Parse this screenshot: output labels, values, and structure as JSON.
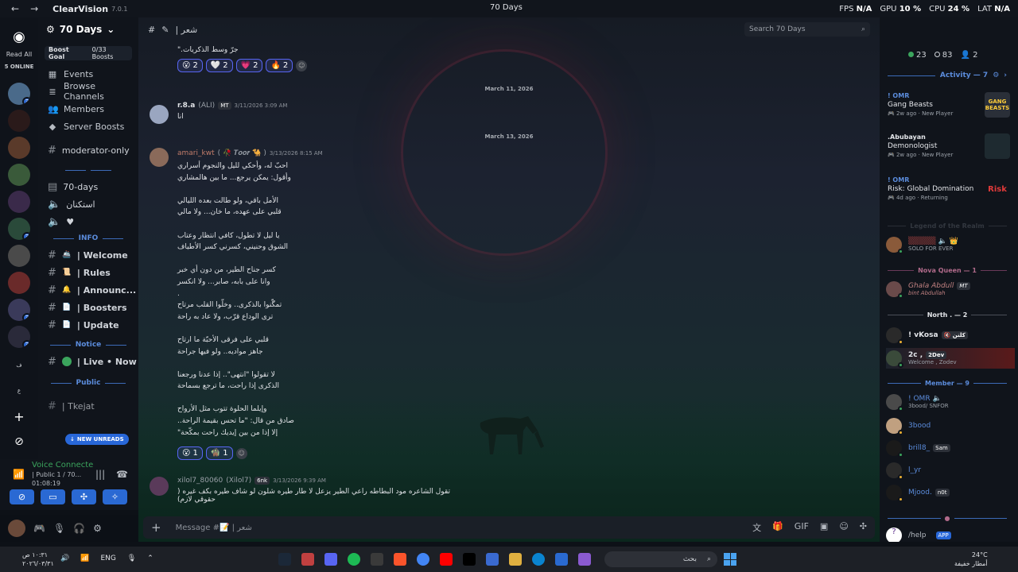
{
  "titlebar": {
    "app_name": "ClearVision",
    "version": "7.0.1",
    "window_title": "70 Days",
    "fps_label": "FPS",
    "fps_value": "N/A",
    "gpu_label": "GPU",
    "gpu_value": "10 %",
    "cpu_label": "CPU",
    "cpu_value": "24 %",
    "lat_label": "LAT",
    "lat_value": "N/A"
  },
  "guild_bar": {
    "read_all": "Read All",
    "online": "5 ONLINE",
    "badge_counts": [
      "3",
      "3",
      "3",
      "3"
    ]
  },
  "sidebar": {
    "server_name": "70 Days",
    "boost_goal": "Boost Goal",
    "boost_count": "0/33 Boosts",
    "nav": [
      "Events",
      "Browse Channels",
      "Members",
      "Server Boosts"
    ],
    "mod_channel": "moderator-only",
    "ch_70days": "70-days",
    "ch_voice1": "استكنان",
    "cat_info": "INFO",
    "info_channels": [
      {
        "emoji": "🚢",
        "label": "| Welcome"
      },
      {
        "emoji": "📜",
        "label": "| Rules"
      },
      {
        "emoji": "🔔",
        "label": "| Announc..."
      },
      {
        "emoji": "📄",
        "label": "| Boosters"
      },
      {
        "emoji": "📄",
        "label": "| Update"
      }
    ],
    "cat_notice": "Notice",
    "live_channel": "| Live • Now",
    "cat_public": "Public",
    "new_unreads": "NEW UNREADS",
    "partial_channel": "| Tkejat"
  },
  "voice": {
    "status": "Voice Connecte",
    "channel": "| Public 1 / 70...",
    "timer": "01:08:19"
  },
  "chat": {
    "channel_name": "| شعر",
    "search_placeholder": "Search 70 Days",
    "top_line": "جرّ وسط الذكريات.\"",
    "reactions1": [
      {
        "e": "😮",
        "n": "2"
      },
      {
        "e": "🤍",
        "n": "2"
      },
      {
        "e": "💗",
        "n": "2"
      },
      {
        "e": "🔥",
        "n": "2"
      }
    ],
    "date1": "March 11, 2026",
    "msg1": {
      "author": "r.8.a",
      "alias": "(ALI)",
      "tag": "MT",
      "time": "3/11/2026 3:09 AM",
      "text": "انا"
    },
    "date2": "March 13, 2026",
    "msg2": {
      "author": "amari_kwt",
      "alias": "( 🥀 𝑻𝒐𝒐𝒓 🐪 )",
      "time": "3/13/2026 8:15 AM",
      "lines": [
        "احبّ له، وأحكي لليل والنجوم أسراري",
        "وأقول: يمكن يرجع... ما بين هالمشاري",
        "",
        "الأمل باقي، ولو طالت بعده الليالي",
        "قلبي على عهده، ما خان... ولا مالي",
        "",
        "يا ليل لا تطول، كافي انتظار وعتاب",
        "الشوق وحنيني، كسرني كسر الأطياف",
        "",
        "كسر جناح الطير، من دون أي خبر",
        "وانا على بابه، صابر... ولا انكسر",
        ".",
        "تمگّنوا بالذكرى.. وخلّوا القلب مرتاح",
        "ترى الوداع قرّب، ولا عاد به راحة",
        "",
        "قلبي على فرقى الأحبّة ما ارتاح",
        "جاهز مواديه.. ولو فيها جراحة",
        "",
        "لا تقولوا \"انتهى\".. إذا عدنا ورجعنا",
        "الذكرى إذا راحت، ما ترجع بسماحة",
        "",
        "وإيلما الحلوة تتوب مثل الأرواح",
        "صادق من قال: \"ما تحس بقيمة الراحة..",
        "إلا إذا من بين إيديك راحت بمكّحة\""
      ]
    },
    "reactions2": [
      {
        "e": "😮",
        "n": "1"
      },
      {
        "e": "🧌",
        "n": "1"
      }
    ],
    "msg3": {
      "author": "xilol7_80060",
      "alias": "(Xilol7)",
      "tag": "6nk",
      "time": "3/13/2026 9:39 AM",
      "text": "تقول الشاعره مود البطاطه راعي الطير يزعل لا طار طيره شلون لو شاف طيره بكف غيره ( حقوقي لازم)"
    },
    "composer_placeholder": "Message #📝 | شعر"
  },
  "members": {
    "counts": {
      "online": "23",
      "idle": "83",
      "other": "2"
    },
    "activity_header": "Activity — 7",
    "activities": [
      {
        "user": "! OMR",
        "game": "Gang Beasts",
        "meta": "2w ago",
        "status": "New Player",
        "art": "GANG BEASTS"
      },
      {
        "user": ".Abubayan",
        "game": "Demonologist",
        "meta": "2w ago",
        "status": "New Player",
        "art": ""
      },
      {
        "user": "! OMR",
        "game": "Risk: Global Domination",
        "meta": "4d ago",
        "status": "Returning",
        "art": "Risk"
      }
    ],
    "role1": "Legend of the Realm",
    "role1_member_sub": "SOLO FOR EVER",
    "role2": "Nova Queen — 1",
    "role2_member": "Ghala Abdull",
    "role2_member_tag": "MT",
    "role2_member_sub": "bint Abdullah",
    "role3": "North . — 2",
    "north": [
      {
        "name": "! vKosa",
        "tag": "🔇 كلنن",
        "sub": ""
      },
      {
        "name": "2c ,",
        "tag": "2Dev",
        "sub": "Welcome , Zodev"
      }
    ],
    "role4": "Member — 9",
    "member_list": [
      {
        "name": "! OMR",
        "tag": "",
        "sub": "3bood/ SNFOR"
      },
      {
        "name": "3bood",
        "tag": "",
        "sub": ""
      },
      {
        "name": "brill8_",
        "tag": "Sam",
        "sub": ""
      },
      {
        "name": "l_yr",
        "tag": "",
        "sub": ""
      },
      {
        "name": "Mjood.",
        "tag": "n0t",
        "sub": ""
      }
    ],
    "help": "/help",
    "app_tag": "APP"
  },
  "taskbar": {
    "time": "١٠:٣١ ص",
    "date": "٢٠٢٦/٠٣/٣١",
    "lang": "ENG",
    "search": "بحث",
    "temp": "24°C",
    "weather": "أمطار خفيفة"
  }
}
